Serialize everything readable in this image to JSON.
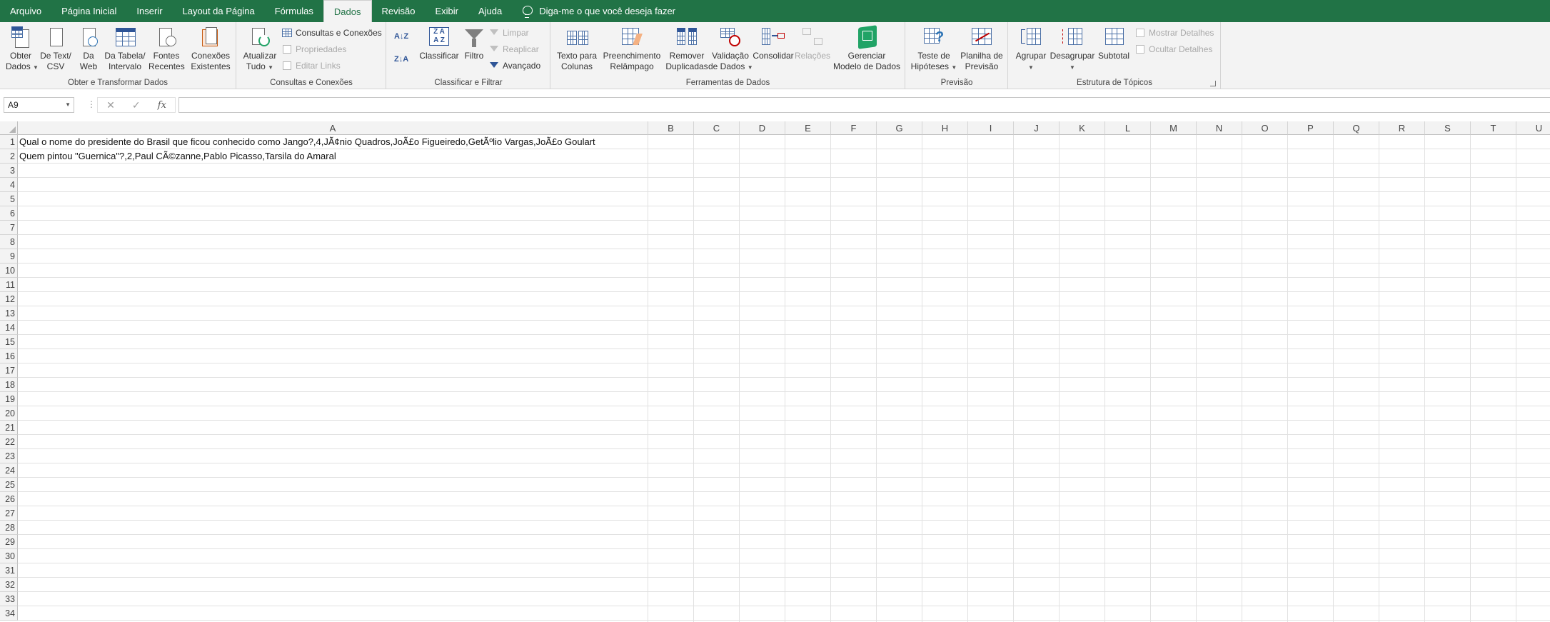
{
  "tabs": [
    {
      "label": "Arquivo",
      "active": false
    },
    {
      "label": "Página Inicial",
      "active": false
    },
    {
      "label": "Inserir",
      "active": false
    },
    {
      "label": "Layout da Página",
      "active": false
    },
    {
      "label": "Fórmulas",
      "active": false
    },
    {
      "label": "Dados",
      "active": true
    },
    {
      "label": "Revisão",
      "active": false
    },
    {
      "label": "Exibir",
      "active": false
    },
    {
      "label": "Ajuda",
      "active": false
    }
  ],
  "tell_me": "Diga-me o que você deseja fazer",
  "ribbon": {
    "get_transform": {
      "label": "Obter e Transformar Dados",
      "obter_dados": [
        "Obter",
        "Dados"
      ],
      "de_texto": [
        "De Text/",
        "CSV"
      ],
      "da_web": [
        "Da",
        "Web"
      ],
      "da_tabela": [
        "Da Tabela/",
        "Intervalo"
      ],
      "fontes_recentes": [
        "Fontes",
        "Recentes"
      ],
      "conexoes_existentes": [
        "Conexões",
        "Existentes"
      ]
    },
    "queries": {
      "label": "Consultas e Conexões",
      "atualizar": [
        "Atualizar",
        "Tudo"
      ],
      "consultas": "Consultas e Conexões",
      "propriedades": "Propriedades",
      "editar_links": "Editar Links"
    },
    "sort_filter": {
      "label": "Classificar e Filtrar",
      "classificar": "Classificar",
      "filtro": "Filtro",
      "limpar": "Limpar",
      "reaplicar": "Reaplicar",
      "avancado": "Avançado"
    },
    "data_tools": {
      "label": "Ferramentas de Dados",
      "texto_colunas": [
        "Texto para",
        "Colunas"
      ],
      "preenchimento": [
        "Preenchimento",
        "Relâmpago"
      ],
      "remover": [
        "Remover",
        "Duplicadas"
      ],
      "validacao": [
        "Validação",
        "de Dados"
      ],
      "consolidar": "Consolidar",
      "relacoes": "Relações",
      "gerenciar": [
        "Gerenciar",
        "Modelo de Dados"
      ]
    },
    "forecast": {
      "label": "Previsão",
      "teste": [
        "Teste de",
        "Hipóteses"
      ],
      "planilha": [
        "Planilha de",
        "Previsão"
      ]
    },
    "outline": {
      "label": "Estrutura de Tópicos",
      "agrupar": "Agrupar",
      "desagrupar": "Desagrupar",
      "subtotal": "Subtotal",
      "mostrar": "Mostrar Detalhes",
      "ocultar": "Ocultar Detalhes"
    }
  },
  "formula_bar": {
    "name_box": "A9",
    "fx": "fx",
    "value": ""
  },
  "sheet": {
    "columns": [
      "A",
      "B",
      "C",
      "D",
      "E",
      "F",
      "G",
      "H",
      "I",
      "J",
      "K",
      "L",
      "M",
      "N",
      "O",
      "P",
      "Q",
      "R",
      "S",
      "T",
      "U"
    ],
    "rows": [
      "1",
      "2",
      "3",
      "4",
      "5",
      "6",
      "7",
      "8",
      "9",
      "10",
      "11",
      "12",
      "13",
      "14",
      "15",
      "16",
      "17",
      "18",
      "19",
      "20",
      "21",
      "22",
      "23",
      "24",
      "25",
      "26",
      "27",
      "28",
      "29",
      "30",
      "31",
      "32",
      "33",
      "34"
    ],
    "cells": {
      "A1": "Qual o nome do presidente do Brasil que ficou conhecido como Jango?,4,JÃ¢nio Quadros,JoÃ£o Figueiredo,GetÃºlio Vargas,JoÃ£o Goulart",
      "A2": "Quem pintou \"Guernica\"?,2,Paul CÃ©zanne,Pablo Picasso,Tarsila do Amaral"
    }
  }
}
